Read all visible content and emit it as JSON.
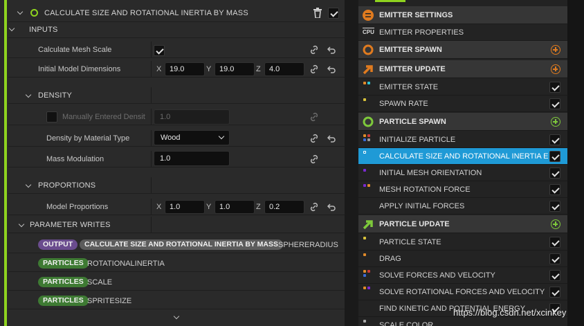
{
  "module": {
    "title": "CALCULATE SIZE AND ROTATIONAL INERTIA BY MASS",
    "enabled": true
  },
  "inputs": {
    "header": "INPUTS",
    "calc_mesh_scale_label": "Calculate Mesh Scale",
    "calc_mesh_scale_checked": true,
    "initial_dims_label": "Initial Model Dimensions",
    "initial_dims": {
      "x_axis": "X",
      "x": "19.0",
      "y_axis": "Y",
      "y": "19.0",
      "z_axis": "Z",
      "z": "4.0"
    },
    "density": {
      "header": "DENSITY",
      "manual_label": "Manually Entered Densit",
      "manual_value": "1.0",
      "by_material_label": "Density by Material Type",
      "material_value": "Wood",
      "mass_mod_label": "Mass Modulation",
      "mass_mod_value": "1.0"
    },
    "proportions": {
      "header": "PROPORTIONS",
      "model_props_label": "Model Proportions",
      "values": {
        "x_axis": "X",
        "x": "1.0",
        "y_axis": "Y",
        "y": "1.0",
        "z_axis": "Z",
        "z": "0.2"
      }
    }
  },
  "parameter_writes": {
    "header": "PARAMETER WRITES",
    "items": [
      {
        "tag": "OUTPUT",
        "module": "CALCULATE SIZE AND ROTATIONAL INERTIA BY MASS",
        "name": "SPHERERADIUS"
      },
      {
        "tag": "PARTICLES",
        "name": "ROTATIONALINERTIA"
      },
      {
        "tag": "PARTICLES",
        "name": "SCALE"
      },
      {
        "tag": "PARTICLES",
        "name": "SPRITESIZE"
      }
    ]
  },
  "stack": {
    "emitter_settings": "EMITTER SETTINGS",
    "emitter_properties": "EMITTER PROPERTIES",
    "emitter_spawn": "EMITTER SPAWN",
    "emitter_update": "EMITTER UPDATE",
    "emitter_state": "EMITTER STATE",
    "spawn_rate": "SPAWN RATE",
    "particle_spawn": "PARTICLE SPAWN",
    "initialize_particle": "INITIALIZE PARTICLE",
    "calc_size": "CALCULATE SIZE AND ROTATIONAL INERTIA E",
    "initial_mesh_orientation": "INITIAL MESH ORIENTATION",
    "mesh_rotation_force": "MESH ROTATION FORCE",
    "apply_initial_forces": "APPLY INITIAL FORCES",
    "particle_update": "PARTICLE UPDATE",
    "particle_state": "PARTICLE STATE",
    "drag": "DRAG",
    "solve_forces": "SOLVE FORCES AND VELOCITY",
    "solve_rot": "SOLVE ROTATIONAL FORCES AND VELOCITY",
    "find_kinetic": "FIND KINETIC AND POTENTIAL ENERGY",
    "scale_color": "SCALE COLOR"
  },
  "watermark": "https://blog.csdn.net/xcinkey",
  "colors": {
    "accent_green": "#8fd31f",
    "selected": "#1f9ad6",
    "orange": "#e07b1f",
    "output_tag": "#6a4c8e",
    "particles_tag": "#3e7a33"
  }
}
